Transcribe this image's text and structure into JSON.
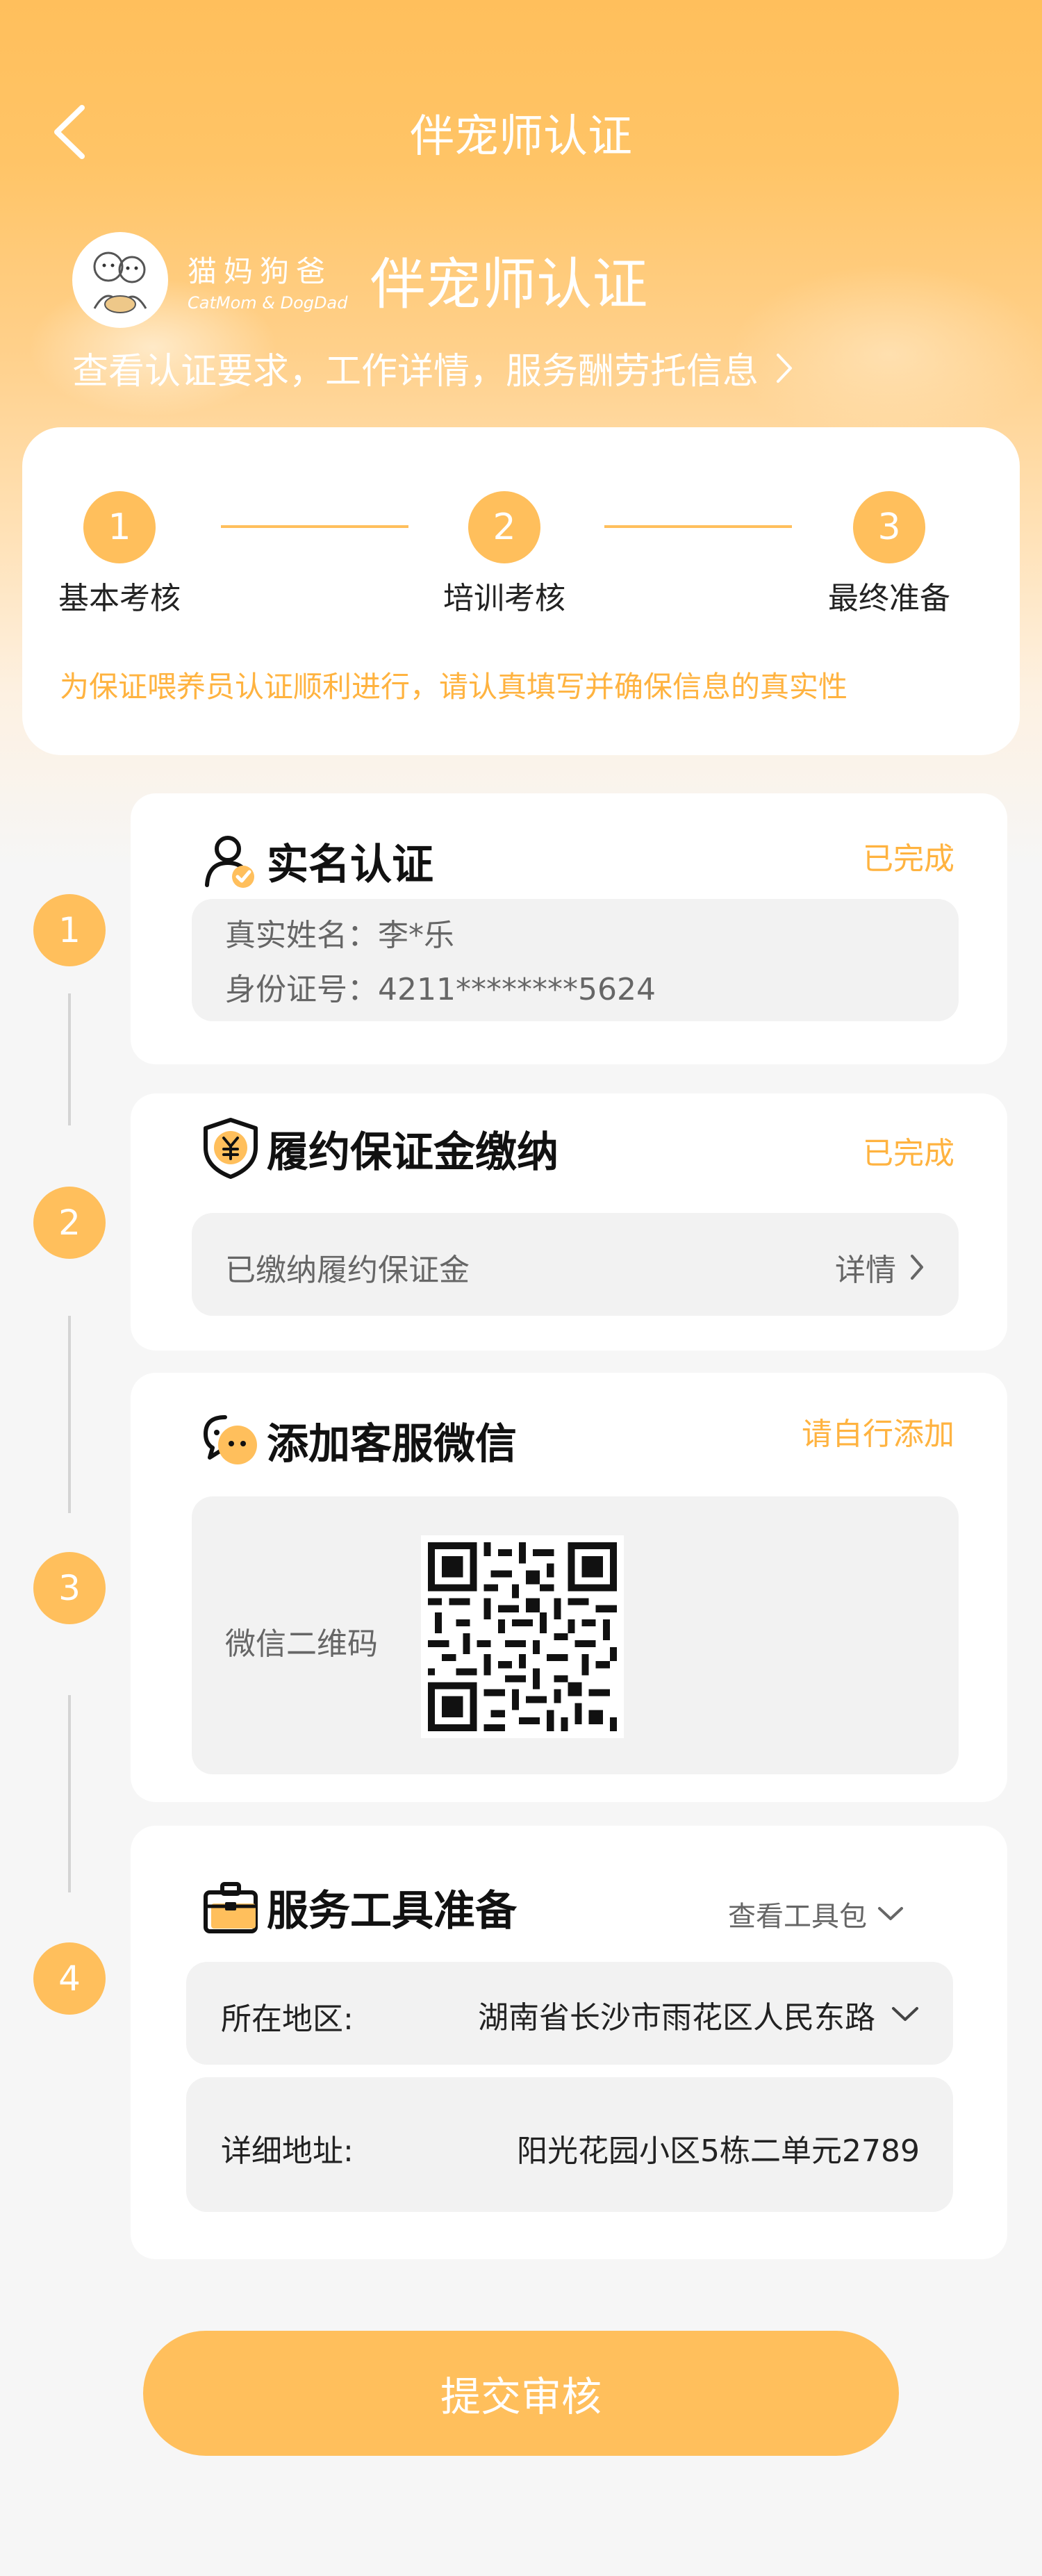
{
  "nav": {
    "title": "伴宠师认证"
  },
  "brand": {
    "logo_cn": "猫妈狗爸",
    "logo_en": "CatMom & DogDad",
    "title": "伴宠师认证",
    "link_text": "查看认证要求，工作详情，服务酬劳托信息"
  },
  "steps": {
    "items": [
      {
        "num": "1",
        "label": "基本考核"
      },
      {
        "num": "2",
        "label": "培训考核"
      },
      {
        "num": "3",
        "label": "最终准备"
      }
    ],
    "note": "为保证喂养员认证顺利进行，请认真填写并确保信息的真实性"
  },
  "timeline": [
    "1",
    "2",
    "3",
    "4"
  ],
  "realname": {
    "title": "实名认证",
    "status": "已完成",
    "name_line": "真实姓名：李*乐",
    "id_line": "身份证号：4211********5624"
  },
  "deposit": {
    "title": "履约保证金缴纳",
    "status": "已完成",
    "row_text": "已缴纳履约保证金",
    "detail_label": "详情"
  },
  "wechat": {
    "title": "添加客服微信",
    "status": "请自行添加",
    "qr_label": "微信二维码"
  },
  "tools": {
    "title": "服务工具准备",
    "view_link": "查看工具包",
    "region_label": "所在地区:",
    "region_value": "湖南省长沙市雨花区人民东路",
    "address_label": "详细地址:",
    "address_value": "阳光花园小区5栋二单元2789"
  },
  "submit_label": "提交审核",
  "colors": {
    "accent": "#ffbf5c",
    "accent_text": "#ffb340",
    "card": "#ffffff",
    "inner": "#f2f2f2"
  },
  "icons": [
    "back-arrow-icon",
    "chevron-right-icon",
    "person-check-icon",
    "shield-yen-icon",
    "chat-bubbles-icon",
    "toolbox-icon",
    "chevron-down-icon",
    "qr-code-icon"
  ]
}
